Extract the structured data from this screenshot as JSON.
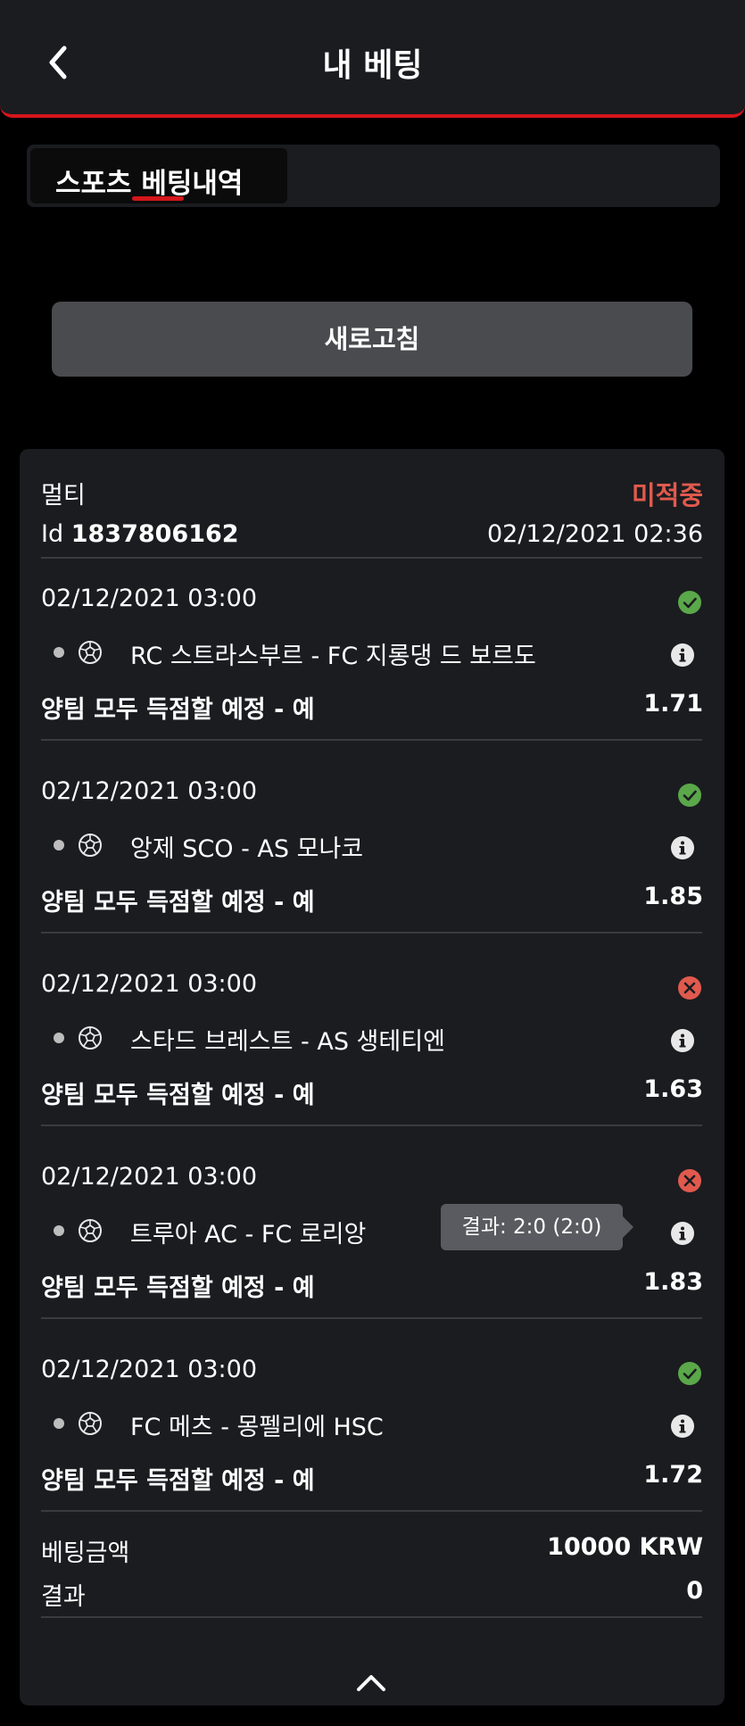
{
  "header": {
    "title": "내 베팅"
  },
  "tabs": [
    {
      "label": "스포츠 베팅내역"
    }
  ],
  "refresh_label": "새로고침",
  "bet": {
    "type": "멀티",
    "status": "미적중",
    "id_prefix": "Id",
    "id": "1837806162",
    "datetime": "02/12/2021 02:36",
    "selections": [
      {
        "datetime": "02/12/2021 03:00",
        "result": "won",
        "match": "RC 스트라스부르 - FC 지롱댕 드 보르도",
        "market": "양팀 모두 득점할 예정 - 예",
        "odds": "1.71"
      },
      {
        "datetime": "02/12/2021 03:00",
        "result": "won",
        "match": "앙제 SCO - AS 모나코",
        "market": "양팀 모두 득점할 예정 - 예",
        "odds": "1.85"
      },
      {
        "datetime": "02/12/2021 03:00",
        "result": "lost",
        "match": "스타드 브레스트 - AS 생테티엔",
        "market": "양팀 모두 득점할 예정 - 예",
        "odds": "1.63"
      },
      {
        "datetime": "02/12/2021 03:00",
        "result": "lost",
        "match": "트루아 AC - FC 로리앙",
        "market": "양팀 모두 득점할 예정 - 예",
        "odds": "1.83",
        "tooltip": "결과: 2:0 (2:0)"
      },
      {
        "datetime": "02/12/2021 03:00",
        "result": "won",
        "match": "FC 메츠 - 몽펠리에 HSC",
        "market": "양팀 모두 득점할 예정 - 예",
        "odds": "1.72"
      }
    ],
    "stake_label": "베팅금액",
    "stake_value": "10000 KRW",
    "result_label": "결과",
    "result_value": "0"
  },
  "colors": {
    "accent": "#d4161b",
    "won": "#5aa84a",
    "lost": "#e05a4d",
    "card": "#1b1c20"
  },
  "icons": {
    "back": "chevron-left-icon",
    "won": "check-circle-icon",
    "lost": "x-circle-icon",
    "info": "info-icon",
    "sport": "soccer-ball-icon",
    "collapse": "chevron-up-icon"
  }
}
